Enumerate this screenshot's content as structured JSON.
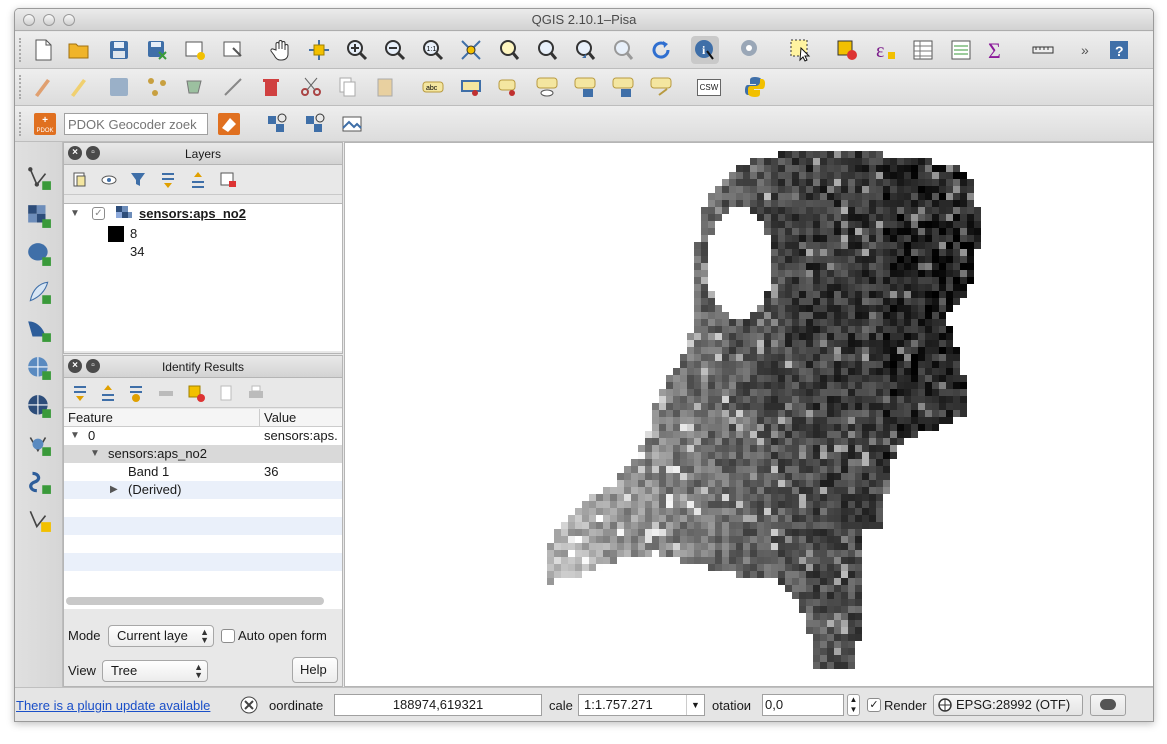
{
  "window": {
    "title": "QGIS 2.10.1–Pisa"
  },
  "toolbar1": {
    "items": [
      "new-project-icon",
      "open-project-icon",
      "save-project-icon",
      "save-as-icon",
      "new-print-composer-icon",
      "composer-manager-icon",
      "pan-icon",
      "pan-to-selection-icon",
      "zoom-in-icon",
      "zoom-out-icon",
      "zoom-native-icon",
      "zoom-full-icon",
      "zoom-to-selection-icon",
      "zoom-to-layer-icon",
      "zoom-last-icon",
      "zoom-next-icon",
      "refresh-icon",
      "identify-icon",
      "map-tips-icon",
      "select-features-icon",
      "deselect-icon",
      "field-calculator-icon",
      "attribute-table-icon",
      "statistics-icon",
      "sum-icon",
      "measure-icon",
      "more-icon",
      "help-icon"
    ]
  },
  "toolbar2": {
    "csw_label": "CSW"
  },
  "toolbar3": {
    "pdok_badge": "PDOK",
    "geocoder_placeholder": "PDOK Geocoder zoek"
  },
  "layers_panel": {
    "title": "Layers",
    "layer_name": "sensors:aps_no2",
    "legend": [
      {
        "label": "8",
        "color": "#000000"
      },
      {
        "label": "34",
        "color": "#ffffff"
      }
    ]
  },
  "identify_panel": {
    "title": "Identify Results",
    "columns": [
      "Feature",
      "Value"
    ],
    "rows": [
      {
        "feature": "0",
        "value": "sensors:aps.",
        "expander": "▼"
      },
      {
        "feature": "sensors:aps_no2",
        "value": "",
        "expander": "▼"
      },
      {
        "feature": "Band 1",
        "value": "36",
        "expander": ""
      },
      {
        "feature": "(Derived)",
        "value": "",
        "expander": "▶"
      }
    ],
    "mode_label": "Mode",
    "mode_value": "Current laye",
    "auto_open_label": "Auto open form",
    "view_label": "View",
    "view_value": "Tree",
    "help_label": "Help"
  },
  "status": {
    "plugin_link": "There is a plugin update available",
    "coordinate_label": "oordinatе",
    "coordinate_value": "188974,619321",
    "scale_label": "calе",
    "scale_value": "1:1.757.271",
    "rotation_label": "otatioи",
    "rotation_value": "0,0",
    "render_label": "Render",
    "crs_label": "EPSG:28992 (OTF)"
  }
}
